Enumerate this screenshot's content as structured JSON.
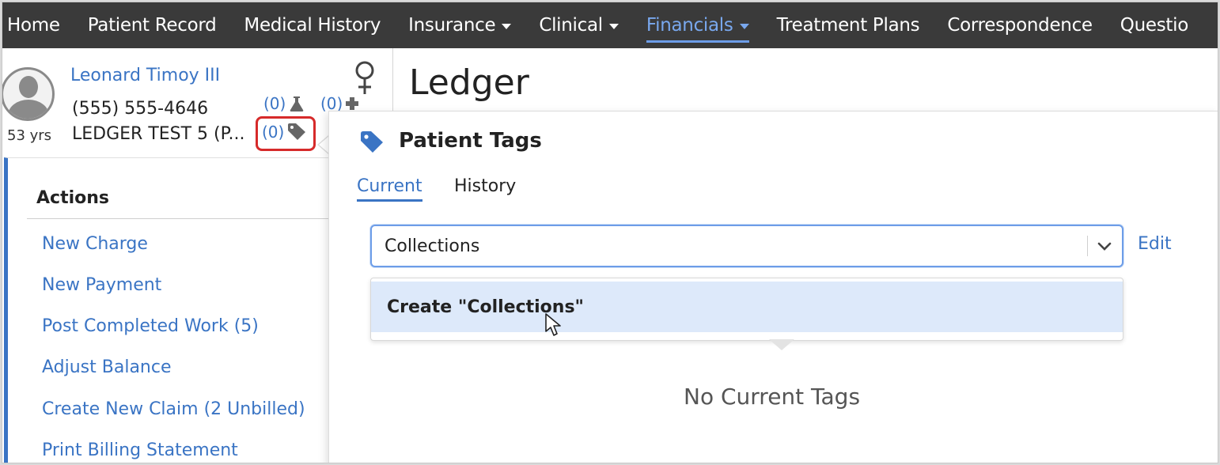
{
  "nav": {
    "items": [
      {
        "label": "Home",
        "dropdown": false,
        "active": false
      },
      {
        "label": "Patient Record",
        "dropdown": false,
        "active": false
      },
      {
        "label": "Medical History",
        "dropdown": false,
        "active": false
      },
      {
        "label": "Insurance",
        "dropdown": true,
        "active": false
      },
      {
        "label": "Clinical",
        "dropdown": true,
        "active": false
      },
      {
        "label": "Financials",
        "dropdown": true,
        "active": true
      },
      {
        "label": "Treatment Plans",
        "dropdown": false,
        "active": false
      },
      {
        "label": "Correspondence",
        "dropdown": false,
        "active": false
      },
      {
        "label": "Questio",
        "dropdown": false,
        "active": false
      }
    ]
  },
  "patient": {
    "name": "Leonard Timoy III",
    "phone": "(555) 555-4646",
    "age": "53 yrs",
    "tag_line": "LEDGER TEST 5 (P...",
    "lab_count": "(0)",
    "medical_count": "(0)",
    "tags_count": "(0)",
    "gender_icon": "female-icon"
  },
  "page": {
    "title": "Ledger"
  },
  "actions": {
    "heading": "Actions",
    "items": [
      "New Charge",
      "New Payment",
      "Post Completed Work (5)",
      "Adjust Balance",
      "Create New Claim (2 Unbilled)",
      "Print Billing Statement"
    ]
  },
  "tags_popover": {
    "title": "Patient Tags",
    "tabs": [
      "Current",
      "History"
    ],
    "active_tab": "Current",
    "input_value": "Collections",
    "edit_label": "Edit",
    "dropdown_option": "Create \"Collections\"",
    "empty_message": "No Current Tags"
  },
  "colors": {
    "accent": "#3a74c4",
    "nav_bg": "#3a3a3a",
    "nav_active": "#79a8ee",
    "highlight_red": "#d62a2a",
    "option_bg": "#dde9fa"
  }
}
